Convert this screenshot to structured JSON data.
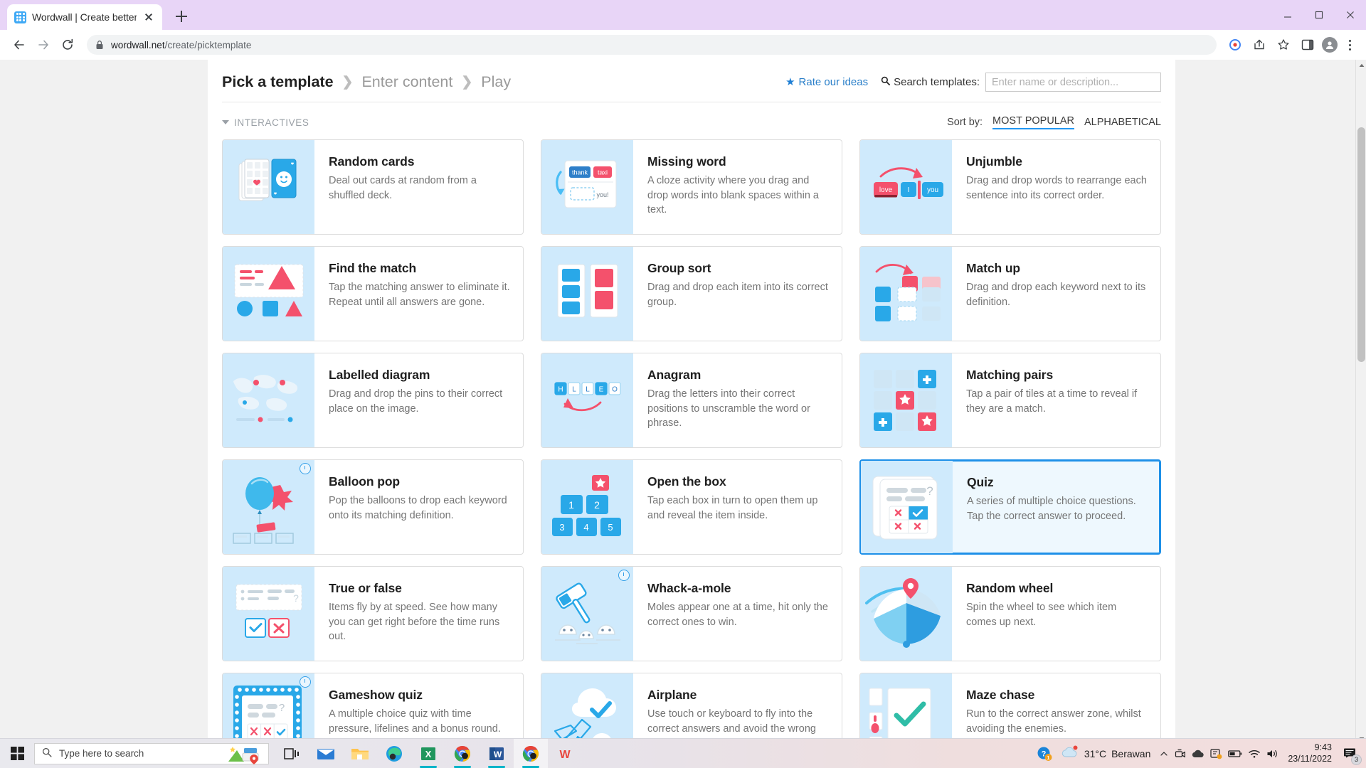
{
  "browser": {
    "tab": {
      "title": "Wordwall | Create better lessons",
      "favicon": "wordwall-favicon"
    },
    "new_tab_label": "+",
    "url_host": "wordwall.net",
    "url_path": "/create/picktemplate",
    "window_buttons": [
      "minimize",
      "maximize",
      "close"
    ],
    "nav": {
      "back": "back-arrow",
      "forward": "forward-arrow",
      "reload": "reload"
    }
  },
  "header": {
    "breadcrumb": [
      {
        "label": "Pick a template",
        "active": true
      },
      {
        "label": "Enter content",
        "active": false
      },
      {
        "label": "Play",
        "active": false
      }
    ],
    "rate_label": "Rate our ideas",
    "search_label": "Search templates:",
    "search_placeholder": "Enter name or description...",
    "search_value": ""
  },
  "section": {
    "title": "INTERACTIVES",
    "sort_label": "Sort by:",
    "sort_options": [
      {
        "label": "MOST POPULAR",
        "active": true
      },
      {
        "label": "ALPHABETICAL",
        "active": false
      }
    ]
  },
  "templates": [
    {
      "title": "Random cards",
      "desc": "Deal out cards at random from a shuffled deck.",
      "thumb": "random-cards",
      "selected": false,
      "timer": false
    },
    {
      "title": "Missing word",
      "desc": "A cloze activity where you drag and drop words into blank spaces within a text.",
      "thumb": "missing-word",
      "selected": false,
      "timer": false
    },
    {
      "title": "Unjumble",
      "desc": "Drag and drop words to rearrange each sentence into its correct order.",
      "thumb": "unjumble",
      "selected": false,
      "timer": false
    },
    {
      "title": "Find the match",
      "desc": "Tap the matching answer to eliminate it. Repeat until all answers are gone.",
      "thumb": "find-the-match",
      "selected": false,
      "timer": false
    },
    {
      "title": "Group sort",
      "desc": "Drag and drop each item into its correct group.",
      "thumb": "group-sort",
      "selected": false,
      "timer": false
    },
    {
      "title": "Match up",
      "desc": "Drag and drop each keyword next to its definition.",
      "thumb": "match-up",
      "selected": false,
      "timer": false
    },
    {
      "title": "Labelled diagram",
      "desc": "Drag and drop the pins to their correct place on the image.",
      "thumb": "labelled-diagram",
      "selected": false,
      "timer": false
    },
    {
      "title": "Anagram",
      "desc": "Drag the letters into their correct positions to unscramble the word or phrase.",
      "thumb": "anagram",
      "selected": false,
      "timer": false
    },
    {
      "title": "Matching pairs",
      "desc": "Tap a pair of tiles at a time to reveal if they are a match.",
      "thumb": "matching-pairs",
      "selected": false,
      "timer": false
    },
    {
      "title": "Balloon pop",
      "desc": "Pop the balloons to drop each keyword onto its matching definition.",
      "thumb": "balloon-pop",
      "selected": false,
      "timer": true
    },
    {
      "title": "Open the box",
      "desc": "Tap each box in turn to open them up and reveal the item inside.",
      "thumb": "open-the-box",
      "selected": false,
      "timer": false
    },
    {
      "title": "Quiz",
      "desc": "A series of multiple choice questions. Tap the correct answer to proceed.",
      "thumb": "quiz",
      "selected": true,
      "timer": false
    },
    {
      "title": "True or false",
      "desc": "Items fly by at speed. See how many you can get right before the time runs out.",
      "thumb": "true-or-false",
      "selected": false,
      "timer": false
    },
    {
      "title": "Whack-a-mole",
      "desc": "Moles appear one at a time, hit only the correct ones to win.",
      "thumb": "whack-a-mole",
      "selected": false,
      "timer": true
    },
    {
      "title": "Random wheel",
      "desc": "Spin the wheel to see which item comes up next.",
      "thumb": "random-wheel",
      "selected": false,
      "timer": false
    },
    {
      "title": "Gameshow quiz",
      "desc": "A multiple choice quiz with time pressure, lifelines and a bonus round.",
      "thumb": "gameshow-quiz",
      "selected": false,
      "timer": true
    },
    {
      "title": "Airplane",
      "desc": "Use touch or keyboard to fly into the correct answers and avoid the wrong ones.",
      "thumb": "airplane",
      "selected": false,
      "timer": false
    },
    {
      "title": "Maze chase",
      "desc": "Run to the correct answer zone, whilst avoiding the enemies.",
      "thumb": "maze-chase",
      "selected": false,
      "timer": false
    }
  ],
  "thumb_text": {
    "missing_word": {
      "a": "thank",
      "b": "taxi",
      "c": "you!"
    },
    "unjumble": {
      "a": "love",
      "b": "I",
      "c": "you"
    },
    "anagram": {
      "letters": [
        "H",
        "L",
        "L",
        "E",
        "O"
      ]
    },
    "open_the_box": {
      "numbers": [
        "1",
        "2",
        "3",
        "4",
        "5"
      ]
    }
  },
  "taskbar": {
    "search_placeholder": "Type here to search",
    "weather_temp": "31°C",
    "weather_desc": "Berawan",
    "time": "9:43",
    "date": "23/11/2022",
    "notification_count": "3",
    "apps": [
      "task-view",
      "mail",
      "file-explorer",
      "edge",
      "excel",
      "chrome",
      "word",
      "chrome-active",
      "wps-office"
    ]
  },
  "colors": {
    "accent": "#1e90e8",
    "thumb_bg": "#cfeafc",
    "card_border": "#dcdcdc",
    "selected_bg": "#eef8fe",
    "link": "#2a7fc9",
    "red": "#f4516c",
    "blue": "#29a8e8"
  }
}
